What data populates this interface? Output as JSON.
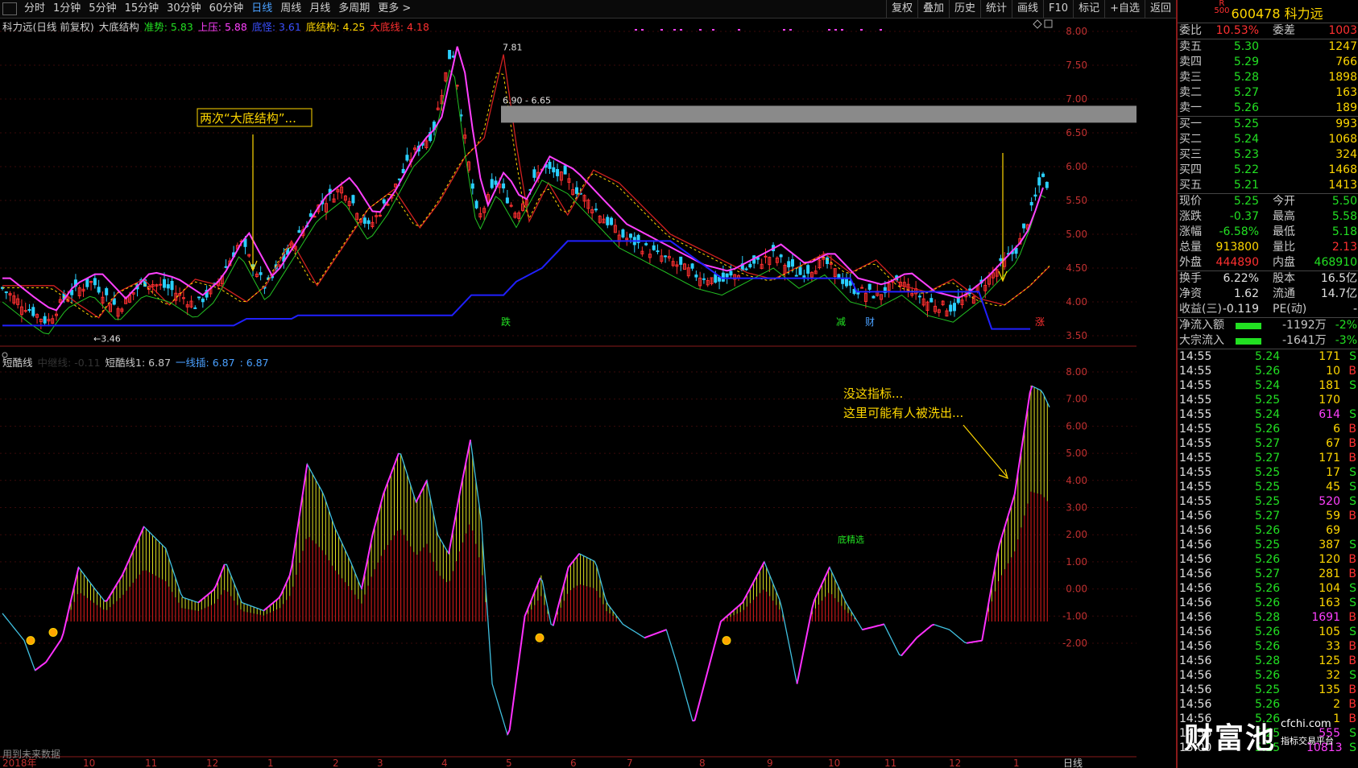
{
  "toolbar": {
    "timeframes": [
      "分时",
      "1分钟",
      "5分钟",
      "15分钟",
      "30分钟",
      "60分钟",
      "日线",
      "周线",
      "月线",
      "多周期",
      "更多 >"
    ],
    "active_index": 6,
    "right_buttons": [
      "复权",
      "叠加",
      "历史",
      "统计",
      "画线",
      "F10",
      "标记",
      "+自选",
      "返回"
    ]
  },
  "stock": {
    "badge": "R\n500",
    "code": "600478",
    "name": "科力远"
  },
  "main_chart": {
    "title": "科力远(日线 前复权)",
    "indicator": "大底结构",
    "items": [
      {
        "label": "准势: 5.83",
        "color": "#22e022"
      },
      {
        "label": "上压: 5.88",
        "color": "#ff40ff"
      },
      {
        "label": "底怪: 3.61",
        "color": "#3a50ff"
      },
      {
        "label": "底结构: 4.25",
        "color": "#ffd700"
      },
      {
        "label": "大底线: 4.18",
        "color": "#ff3030"
      }
    ],
    "annotation": "两次“大底结构”...",
    "high_label": "7.81",
    "low_label": "3.46",
    "zone_label": "6.90 - 6.65",
    "y_labels": [
      "8.00",
      "7.50",
      "7.00",
      "6.50",
      "6.00",
      "5.50",
      "5.00",
      "4.50",
      "4.00",
      "3.50"
    ],
    "markers": [
      "跌",
      "减",
      "财",
      "涨"
    ]
  },
  "sub_chart": {
    "title": "短酷线",
    "items": [
      {
        "label": "中继线: -0.11",
        "color": "#333333"
      },
      {
        "label": "短酷线1: 6.87",
        "color": "#c8c8c8"
      },
      {
        "label": "一线插: 6.87",
        "color": "#4aa0ff"
      },
      {
        "label": ": 6.87",
        "color": "#4aa0ff"
      }
    ],
    "annotation_line1": "没这指标...",
    "annotation_line2": "这里可能有人被洗出...",
    "bottom_label": "底精选",
    "y_labels": [
      "8.00",
      "7.00",
      "6.00",
      "5.00",
      "4.00",
      "3.00",
      "2.00",
      "1.00",
      "0.00",
      "-1.00",
      "-2.00"
    ],
    "footer": "用到未来数据"
  },
  "x_axis": [
    "2018年",
    "10",
    "11",
    "12",
    "1",
    "2",
    "3",
    "4",
    "5",
    "6",
    "7",
    "8",
    "9",
    "10",
    "11",
    "12",
    "1"
  ],
  "x_right": "日线",
  "quote": {
    "weibi": {
      "label": "委比",
      "value": "10.53%",
      "label2": "委差",
      "value2": "1003"
    },
    "asks": [
      {
        "label": "卖五",
        "price": "5.30",
        "qty": "1247"
      },
      {
        "label": "卖四",
        "price": "5.29",
        "qty": "766"
      },
      {
        "label": "卖三",
        "price": "5.28",
        "qty": "1898"
      },
      {
        "label": "卖二",
        "price": "5.27",
        "qty": "163"
      },
      {
        "label": "卖一",
        "price": "5.26",
        "qty": "189"
      }
    ],
    "bids": [
      {
        "label": "买一",
        "price": "5.25",
        "qty": "993"
      },
      {
        "label": "买二",
        "price": "5.24",
        "qty": "1068"
      },
      {
        "label": "买三",
        "price": "5.23",
        "qty": "324"
      },
      {
        "label": "买四",
        "price": "5.22",
        "qty": "1468"
      },
      {
        "label": "买五",
        "price": "5.21",
        "qty": "1413"
      }
    ],
    "stats": [
      {
        "l": "现价",
        "v": "5.25",
        "c1": "green",
        "l2": "今开",
        "v2": "5.50",
        "c2": "green"
      },
      {
        "l": "涨跌",
        "v": "-0.37",
        "c1": "green",
        "l2": "最高",
        "v2": "5.58",
        "c2": "green"
      },
      {
        "l": "涨幅",
        "v": "-6.58%",
        "c1": "green",
        "l2": "最低",
        "v2": "5.18",
        "c2": "green"
      },
      {
        "l": "总量",
        "v": "913800",
        "c1": "yellow",
        "l2": "量比",
        "v2": "2.13",
        "c2": "red"
      },
      {
        "l": "外盘",
        "v": "444890",
        "c1": "red",
        "l2": "内盘",
        "v2": "468910",
        "c2": "green"
      }
    ],
    "stats2": [
      {
        "l": "换手",
        "v": "6.22%",
        "c1": "white",
        "l2": "股本",
        "v2": "16.5亿",
        "c2": "white"
      },
      {
        "l": "净资",
        "v": "1.62",
        "c1": "white",
        "l2": "流通",
        "v2": "14.7亿",
        "c2": "white"
      },
      {
        "l": "收益(三)",
        "v": "-0.119",
        "c1": "white",
        "l2": "PE(动)",
        "v2": "-",
        "c2": "white"
      }
    ],
    "flows": [
      {
        "label": "净流入额",
        "value": "-1192万",
        "pct": "-2%"
      },
      {
        "label": "大宗流入",
        "value": "-1641万",
        "pct": "-3%"
      }
    ]
  },
  "ticks": [
    [
      "14:55",
      "5.24",
      "171",
      "S"
    ],
    [
      "14:55",
      "5.26",
      "10",
      "B"
    ],
    [
      "14:55",
      "5.24",
      "181",
      "S"
    ],
    [
      "14:55",
      "5.25",
      "170",
      ""
    ],
    [
      "14:55",
      "5.24",
      "614",
      "S"
    ],
    [
      "14:55",
      "5.26",
      "6",
      "B"
    ],
    [
      "14:55",
      "5.27",
      "67",
      "B"
    ],
    [
      "14:55",
      "5.27",
      "171",
      "B"
    ],
    [
      "14:55",
      "5.25",
      "17",
      "S"
    ],
    [
      "14:55",
      "5.25",
      "45",
      "S"
    ],
    [
      "14:55",
      "5.25",
      "520",
      "S"
    ],
    [
      "14:56",
      "5.27",
      "59",
      "B"
    ],
    [
      "14:56",
      "5.26",
      "69",
      ""
    ],
    [
      "14:56",
      "5.25",
      "387",
      "S"
    ],
    [
      "14:56",
      "5.26",
      "120",
      "B"
    ],
    [
      "14:56",
      "5.27",
      "281",
      "B"
    ],
    [
      "14:56",
      "5.26",
      "104",
      "S"
    ],
    [
      "14:56",
      "5.26",
      "163",
      "S"
    ],
    [
      "14:56",
      "5.28",
      "1691",
      "B"
    ],
    [
      "14:56",
      "5.26",
      "105",
      "S"
    ],
    [
      "14:56",
      "5.26",
      "33",
      "B"
    ],
    [
      "14:56",
      "5.28",
      "125",
      "B"
    ],
    [
      "14:56",
      "5.26",
      "32",
      "S"
    ],
    [
      "14:56",
      "5.25",
      "135",
      "B"
    ],
    [
      "14:56",
      "5.26",
      "2",
      "B"
    ],
    [
      "14:56",
      "5.26",
      "1",
      "B"
    ],
    [
      "14:56",
      "5.25",
      "555",
      "S"
    ],
    [
      "15:00",
      "5.25",
      "10813",
      "S"
    ]
  ],
  "watermark": {
    "big": "财富池",
    "site": "cfchi.com",
    "sub": "指标交易平台"
  }
}
